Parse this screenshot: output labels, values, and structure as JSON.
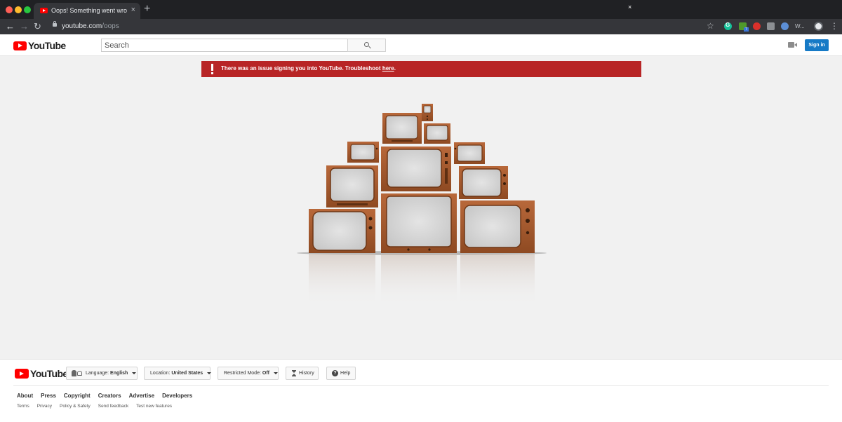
{
  "browser": {
    "tab_title": "Oops! Something went wrong.",
    "tab_close": "×",
    "new_tab": "+",
    "url_domain": "youtube.com",
    "url_path": "/oops",
    "back": "←",
    "forward": "→",
    "reload": "↻",
    "star": "☆",
    "menu": "⋮",
    "ext_badge": "7",
    "ext_w": "W..."
  },
  "header": {
    "logo_text": "YouTube",
    "search_placeholder": "Search",
    "signin_label": "Sign in"
  },
  "alert": {
    "message": "There was an issue signing you into YouTube. Troubleshoot ",
    "link_text": "here",
    "suffix": ".",
    "close": "×",
    "background": "#b82526"
  },
  "footer": {
    "logo_text": "YouTube",
    "language_label": "Language:",
    "language_value": "English",
    "location_label": "Location:",
    "location_value": "United States",
    "restricted_label": "Restricted Mode:",
    "restricted_value": "Off",
    "history_label": "History",
    "help_label": "Help",
    "help_glyph": "?",
    "primary_links": [
      "About",
      "Press",
      "Copyright",
      "Creators",
      "Advertise",
      "Developers"
    ],
    "secondary_links": [
      "Terms",
      "Privacy",
      "Policy & Safety",
      "Send feedback",
      "Test new features"
    ]
  },
  "colors": {
    "brand_red": "#ff0000",
    "signin_blue": "#167ac6",
    "page_bg": "#f1f1f1",
    "tv_wood": "#a85a2c"
  }
}
